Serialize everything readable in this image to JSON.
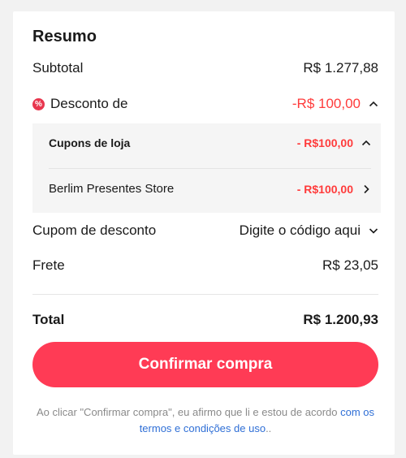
{
  "summary": {
    "title": "Resumo",
    "subtotal_label": "Subtotal",
    "subtotal_value": "R$ 1.277,88",
    "discount_icon": "percent-badge-icon",
    "discount_label": "Desconto de",
    "discount_value": "-R$ 100,00",
    "store_coupons_label": "Cupons de loja",
    "store_coupons_value": "- R$100,00",
    "store_name": "Berlim Presentes Store",
    "store_value": "- R$100,00",
    "coupon_label": "Cupom de desconto",
    "coupon_placeholder": "Digite o código aqui",
    "shipping_label": "Frete",
    "shipping_value": "R$ 23,05",
    "total_label": "Total",
    "total_value": "R$ 1.200,93"
  },
  "actions": {
    "confirm_label": "Confirmar compra"
  },
  "disclaimer": {
    "text": "Ao clicar \"Confirmar compra\", eu afirmo que li e estou de acordo ",
    "link_text": "com os termos e condições de uso",
    "suffix": ".."
  },
  "colors": {
    "accent": "#ff3b55",
    "discount_red": "#ff3b3b",
    "link_blue": "#2f6fd6"
  }
}
